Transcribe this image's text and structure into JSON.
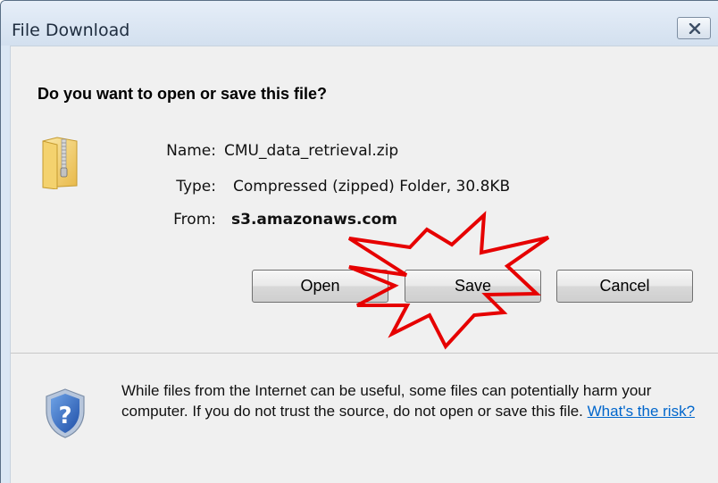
{
  "window": {
    "title": "File Download"
  },
  "dialog": {
    "heading": "Do you want to open or save this file?",
    "file": {
      "name_label": "Name:",
      "name_value": "CMU_data_retrieval.zip",
      "type_label": "Type:",
      "type_value": "Compressed (zipped) Folder, 30.8KB",
      "from_label": "From:",
      "from_value": "s3.amazonaws.com"
    },
    "buttons": {
      "open": "Open",
      "save": "Save",
      "cancel": "Cancel"
    },
    "warning_text": "While files from the Internet can be useful, some files can potentially harm your computer. If you do not trust the source, do not open or save this file.",
    "risk_link": "What's the risk?"
  },
  "icons": {
    "file": "zip-folder-icon",
    "shield": "security-shield-question-icon",
    "close": "close-icon",
    "highlight": "starburst-highlight"
  },
  "colors": {
    "starburst_stroke": "#e60000",
    "link": "#0066cc"
  }
}
